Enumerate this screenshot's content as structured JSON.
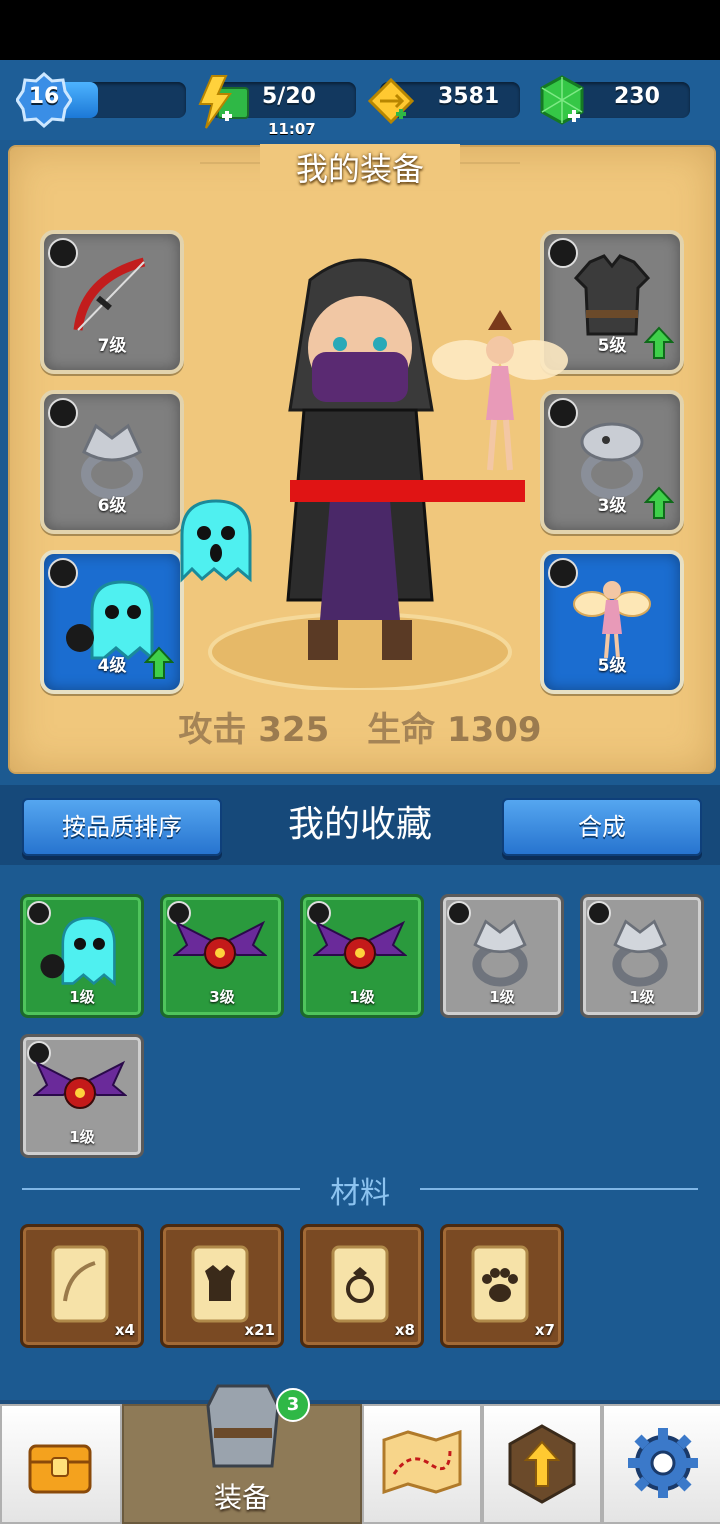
{
  "topbar": {
    "level": "16",
    "xp_fraction": 0.42,
    "energy": "5/20",
    "energy_timer": "11:07",
    "gold": "3581",
    "gems": "230"
  },
  "equipment": {
    "title": "我的装备",
    "slots_left": [
      {
        "level": "7级",
        "item": "bow-icon",
        "style": "gray"
      },
      {
        "level": "6级",
        "item": "wolf-ring-icon",
        "style": "gray"
      },
      {
        "level": "4级",
        "item": "ghost-pet-icon",
        "style": "blue",
        "upgrade": true
      }
    ],
    "slots_right": [
      {
        "level": "5级",
        "item": "armor-icon",
        "style": "gray",
        "upgrade": true
      },
      {
        "level": "3级",
        "item": "serpent-ring-icon",
        "style": "gray",
        "upgrade": true
      },
      {
        "level": "5级",
        "item": "fairy-pet-icon",
        "style": "blue"
      }
    ],
    "attack_label": "攻击",
    "attack_value": "325",
    "hp_label": "生命",
    "hp_value": "1309"
  },
  "collection": {
    "sort_button": "按品质排序",
    "title": "我的收藏",
    "merge_button": "合成",
    "items": [
      {
        "level": "1级",
        "item": "ghost-pet-icon",
        "style": "green"
      },
      {
        "level": "3级",
        "item": "bat-pet-icon",
        "style": "green"
      },
      {
        "level": "1级",
        "item": "bat-pet-icon",
        "style": "green"
      },
      {
        "level": "1级",
        "item": "wolf-ring-icon",
        "style": "gray"
      },
      {
        "level": "1级",
        "item": "wolf-ring-icon",
        "style": "gray"
      },
      {
        "level": "1级",
        "item": "bat-pet-icon",
        "style": "gray"
      }
    ]
  },
  "materials": {
    "title": "材料",
    "items": [
      {
        "count": "x4",
        "item": "bow-scroll-icon"
      },
      {
        "count": "x21",
        "item": "armor-scroll-icon"
      },
      {
        "count": "x8",
        "item": "ring-scroll-icon"
      },
      {
        "count": "x7",
        "item": "paw-scroll-icon"
      }
    ]
  },
  "nav": {
    "active_label": "装备",
    "badge": "3",
    "tabs": [
      "chest-icon",
      "equipment-icon",
      "map-icon",
      "upgrade-icon",
      "settings-icon"
    ]
  },
  "colors": {
    "panel": "#f0c77c",
    "background": "#1c5a91",
    "green_item": "#2a9a3d",
    "blue_slot": "#1b6dd0"
  }
}
